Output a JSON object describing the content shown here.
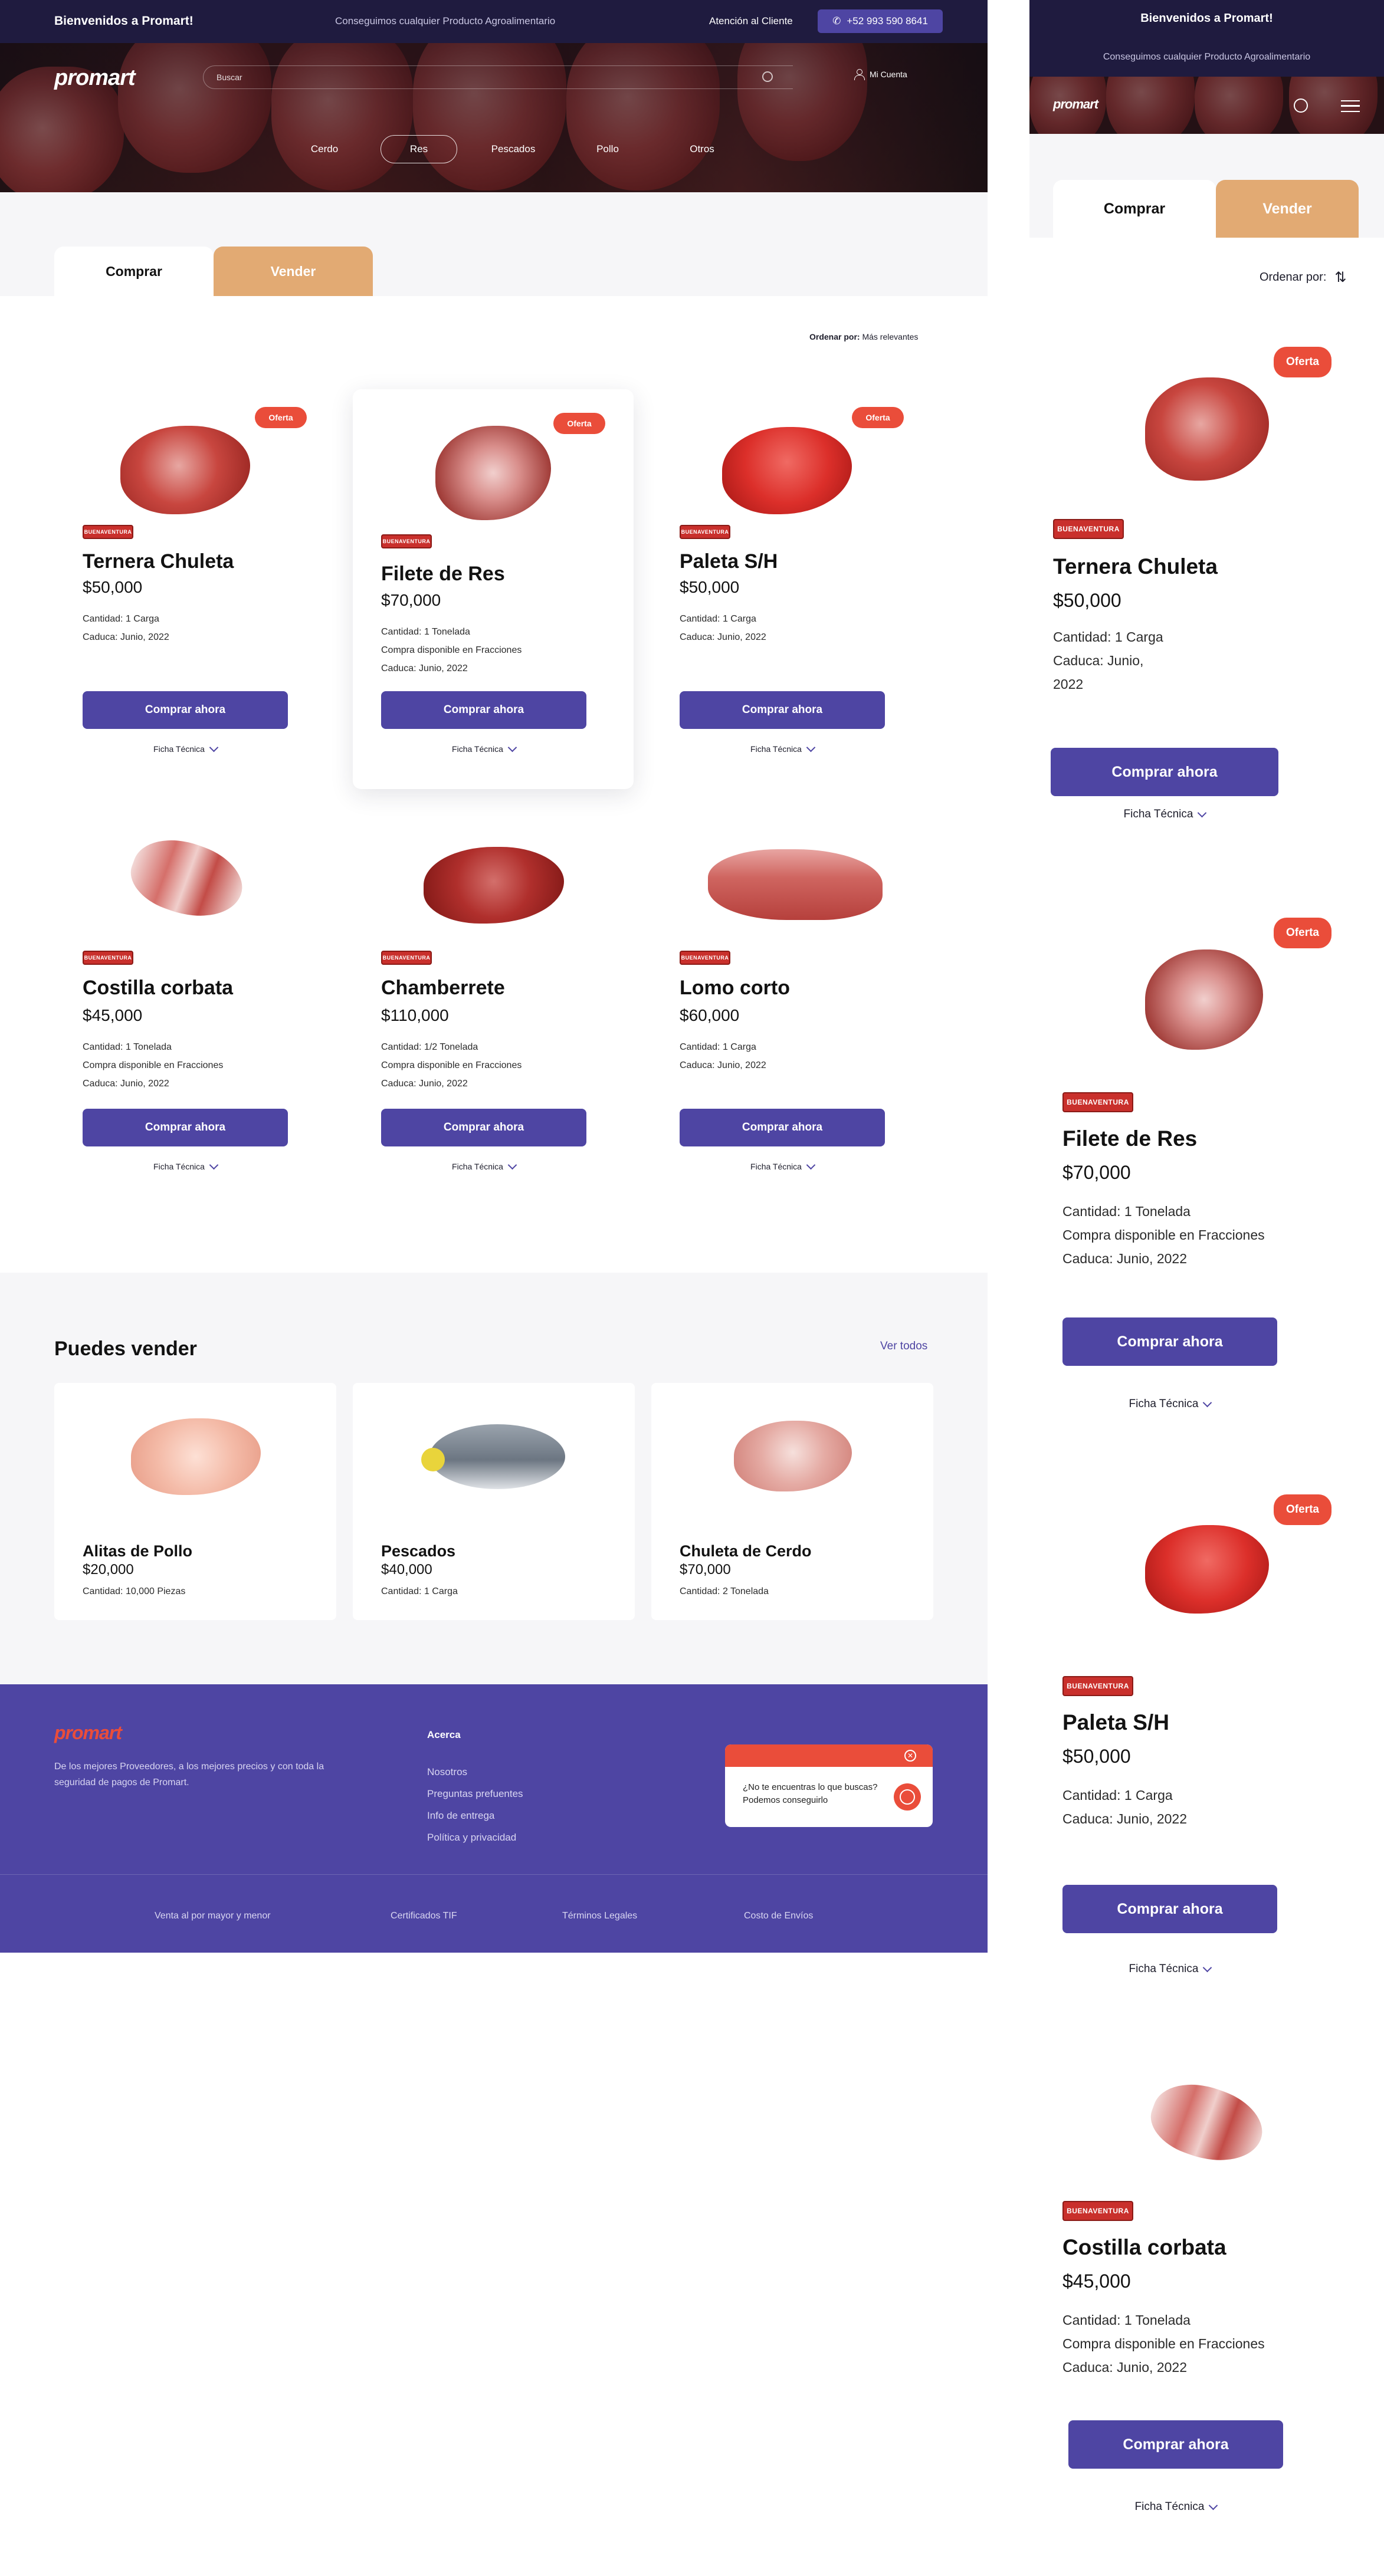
{
  "topbar": {
    "welcome": "Bienvenidos a Promart!",
    "tagline": "Conseguimos cualquier Producto Agroalimentario",
    "attention": "Atención al Cliente",
    "phone": "+52 993 590 8641"
  },
  "header": {
    "logo": "promart",
    "search_placeholder": "Buscar",
    "account": "Mi Cuenta"
  },
  "categories": [
    "Cerdo",
    "Res",
    "Pescados",
    "Pollo",
    "Otros"
  ],
  "active_category": "Res",
  "tabs": {
    "buy": "Comprar",
    "sell": "Vender"
  },
  "sort": {
    "label": "Ordenar por:",
    "value": "Más relevantes"
  },
  "brand": "BUENAVENTURA",
  "common": {
    "buy_label": "Comprar ahora",
    "ficha_label": "Ficha Técnica",
    "offer_label": "Oferta"
  },
  "products": [
    {
      "name": "Ternera Chuleta",
      "price": "$50,000",
      "line1": "Cantidad: 1 Carga",
      "line2": "Caduca: Junio, 2022",
      "line3": ""
    },
    {
      "name": "Filete de Res",
      "price": "$70,000",
      "line1": "Cantidad: 1 Tonelada",
      "line2": "Compra disponible en Fracciones",
      "line3": "Caduca: Junio, 2022"
    },
    {
      "name": "Paleta S/H",
      "price": "$50,000",
      "line1": "Cantidad: 1 Carga",
      "line2": "Caduca: Junio, 2022",
      "line3": ""
    },
    {
      "name": "Costilla corbata",
      "price": "$45,000",
      "line1": "Cantidad: 1 Tonelada",
      "line2": "Compra disponible en Fracciones",
      "line3": "Caduca: Junio, 2022"
    },
    {
      "name": "Chamberrete",
      "price": "$110,000",
      "line1": "Cantidad: 1/2 Tonelada",
      "line2": "Compra disponible en Fracciones",
      "line3": "Caduca: Junio, 2022"
    },
    {
      "name": "Lomo corto",
      "price": "$60,000",
      "line1": "Cantidad: 1 Carga",
      "line2": "Caduca: Junio, 2022",
      "line3": ""
    }
  ],
  "sell": {
    "heading": "Puedes vender",
    "see_all": "Ver todos",
    "items": [
      {
        "name": "Alitas de Pollo",
        "price": "$20,000",
        "qty": "Cantidad: 10,000 Piezas"
      },
      {
        "name": "Pescados",
        "price": "$40,000",
        "qty": "Cantidad: 1 Carga"
      },
      {
        "name": "Chuleta de Cerdo",
        "price": "$70,000",
        "qty": "Cantidad: 2 Tonelada"
      }
    ]
  },
  "footer": {
    "logo": "promart",
    "description": "De los mejores Proveedores, a los mejores precios y con toda la seguridad de pagos de Promart.",
    "about_heading": "Acerca",
    "links": [
      "Nosotros",
      "Preguntas prefuentes",
      "Info de entrega",
      "Política y privacidad"
    ],
    "chat_message": "¿No te encuentras lo que buscas? Podemos conseguirlo",
    "bottom_links": [
      "Venta al por mayor y menor",
      "Certificados TIF",
      "Términos Legales",
      "Costo de Envíos"
    ]
  },
  "mobile": {
    "sort_label": "Ordenar por:",
    "products": [
      {
        "name": "Ternera Chuleta",
        "price": "$50,000",
        "line1": "Cantidad: 1 Carga",
        "line2": "Caduca: Junio,",
        "line3": "2022"
      },
      {
        "name": "Filete de Res",
        "price": "$70,000",
        "line1": "Cantidad: 1 Tonelada",
        "line2": "Compra disponible en Fracciones",
        "line3": "Caduca: Junio, 2022"
      },
      {
        "name": "Paleta S/H",
        "price": "$50,000",
        "line1": "Cantidad: 1 Carga",
        "line2": "Caduca: Junio, 2022",
        "line3": ""
      },
      {
        "name": "Costilla corbata",
        "price": "$45,000",
        "line1": "Cantidad: 1 Tonelada",
        "line2": "Compra disponible en Fracciones",
        "line3": "Caduca: Junio, 2022"
      }
    ]
  },
  "colors": {
    "primary": "#4e45a3",
    "dark": "#1f1b3f",
    "accent": "#ea4d3a",
    "sell_tab": "#e2aa73",
    "bg_light": "#f6f6f8"
  }
}
